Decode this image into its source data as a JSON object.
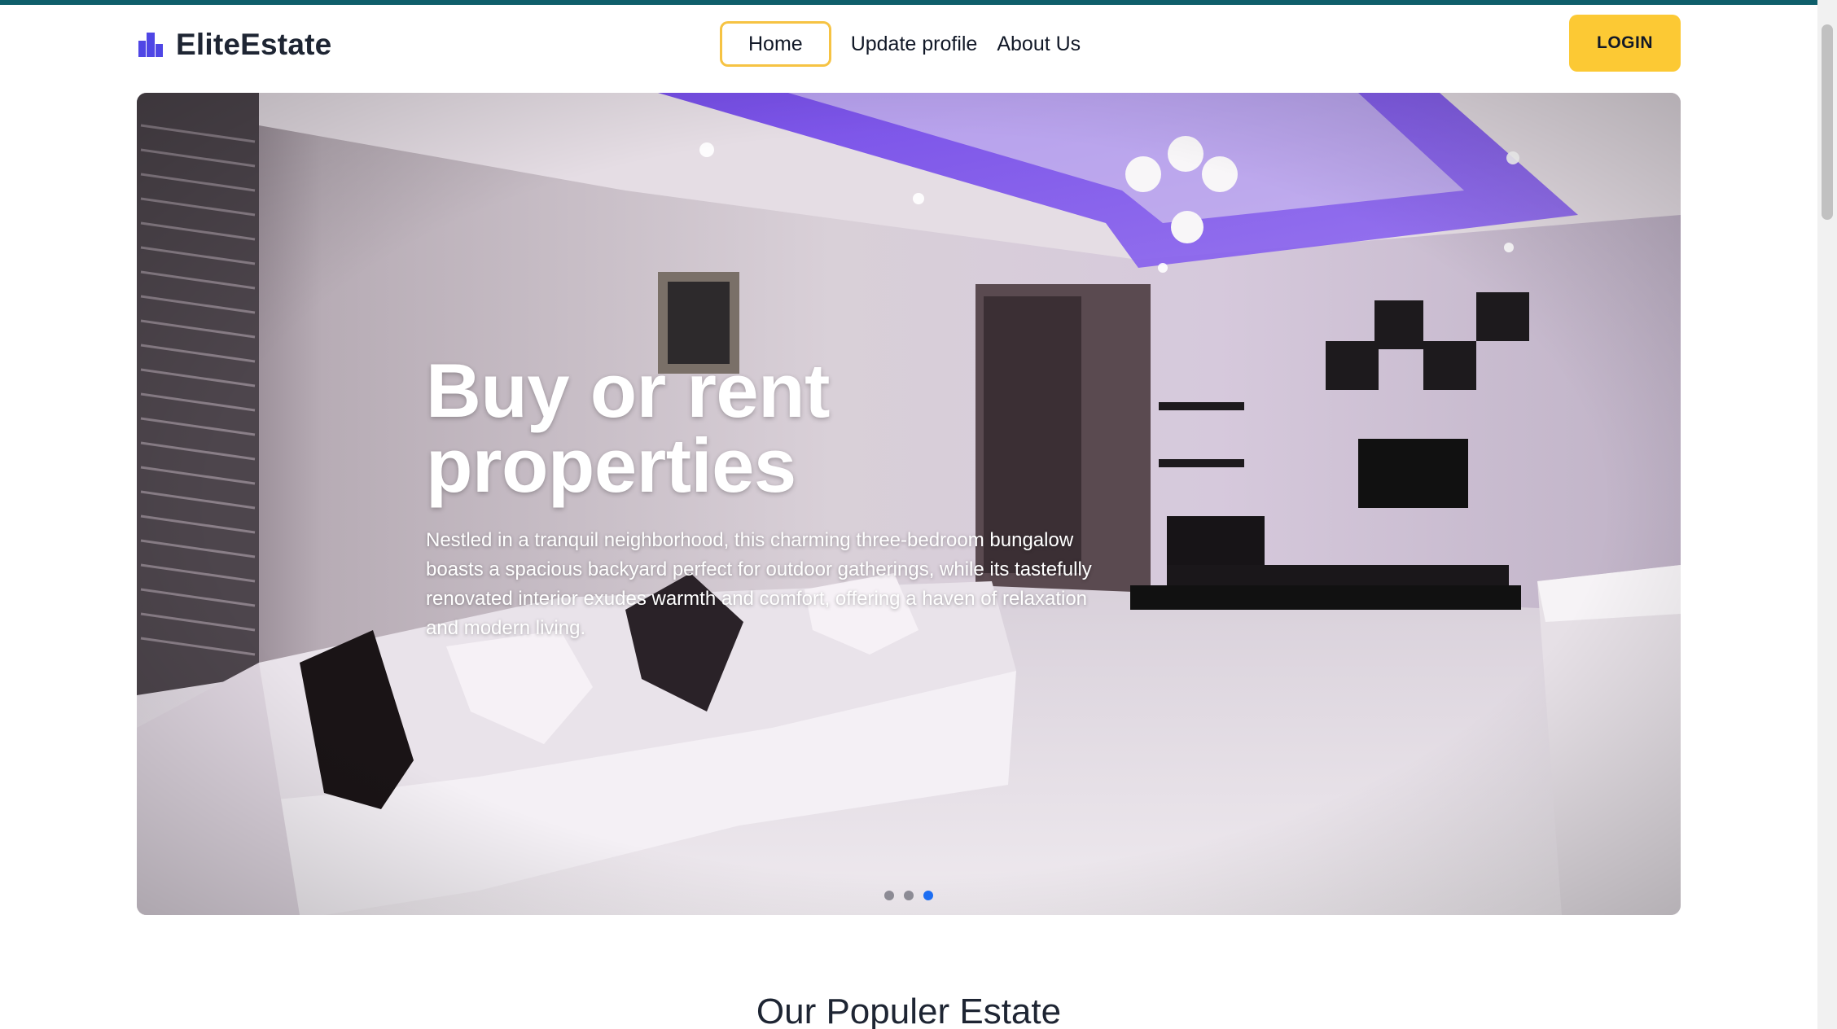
{
  "brand": {
    "name": "EliteEstate",
    "icon": "buildings-icon",
    "color": "#4f46e5"
  },
  "nav": {
    "items": [
      {
        "label": "Home",
        "active": true
      },
      {
        "label": "Update profile",
        "active": false
      },
      {
        "label": "About Us",
        "active": false
      }
    ],
    "login_label": "LOGIN"
  },
  "hero": {
    "title": "Buy or rent properties",
    "description": "Nestled in a tranquil neighborhood, this charming three-bedroom bungalow boasts a spacious backyard perfect for outdoor gatherings, while its tastefully renovated interior exudes warmth and comfort, offering a haven of relaxation and modern living.",
    "slides": 3,
    "active_slide": 3
  },
  "section": {
    "title": "Our Populer Estate"
  },
  "colors": {
    "accent": "#fcc934",
    "active_border": "#f6c343",
    "dot_active": "#1d6ef2",
    "top_bar": "#0f5f6b"
  }
}
